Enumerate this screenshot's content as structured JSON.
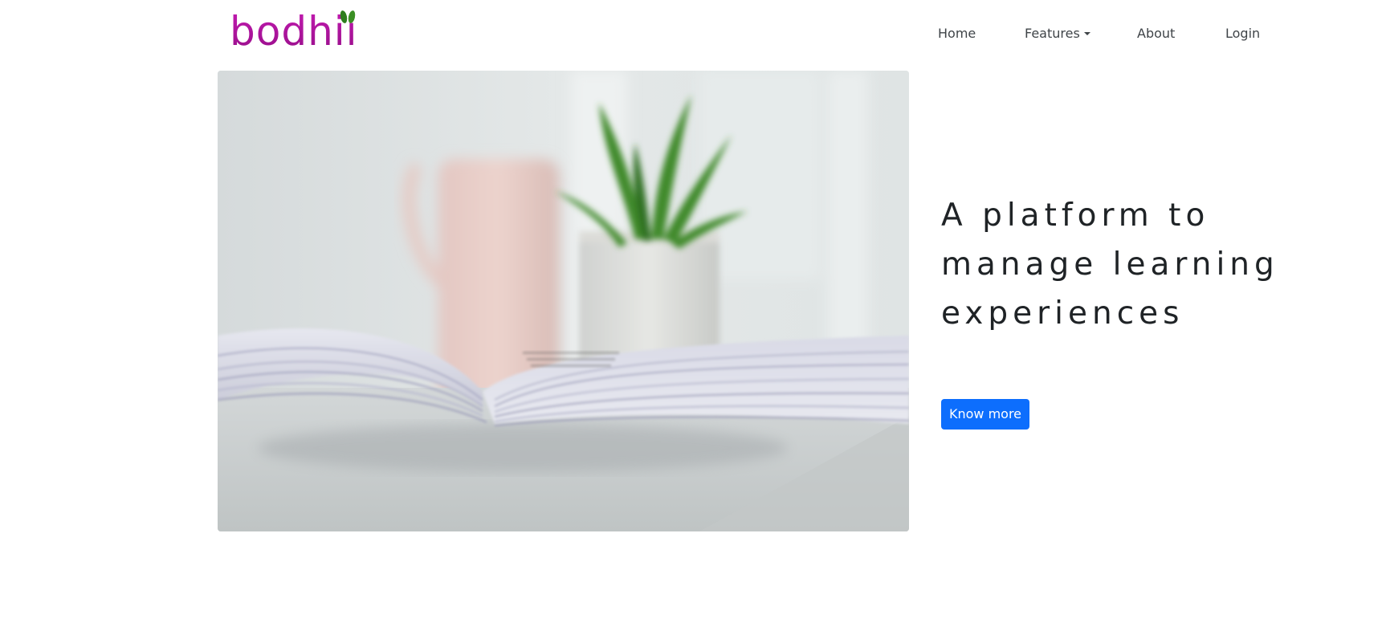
{
  "brand": {
    "logo_text": "bodhii",
    "logo_color": "#b0129f",
    "leaf_color": "#2e7d1e"
  },
  "nav": {
    "items": [
      {
        "label": "Home"
      },
      {
        "label": "Features",
        "dropdown": true
      },
      {
        "label": "About"
      },
      {
        "label": "Login"
      }
    ]
  },
  "hero": {
    "image_icon": "open-book-photo",
    "heading": "A platform to manage learning experiences",
    "button_label": "Know more",
    "button_color": "#0d6efd"
  }
}
